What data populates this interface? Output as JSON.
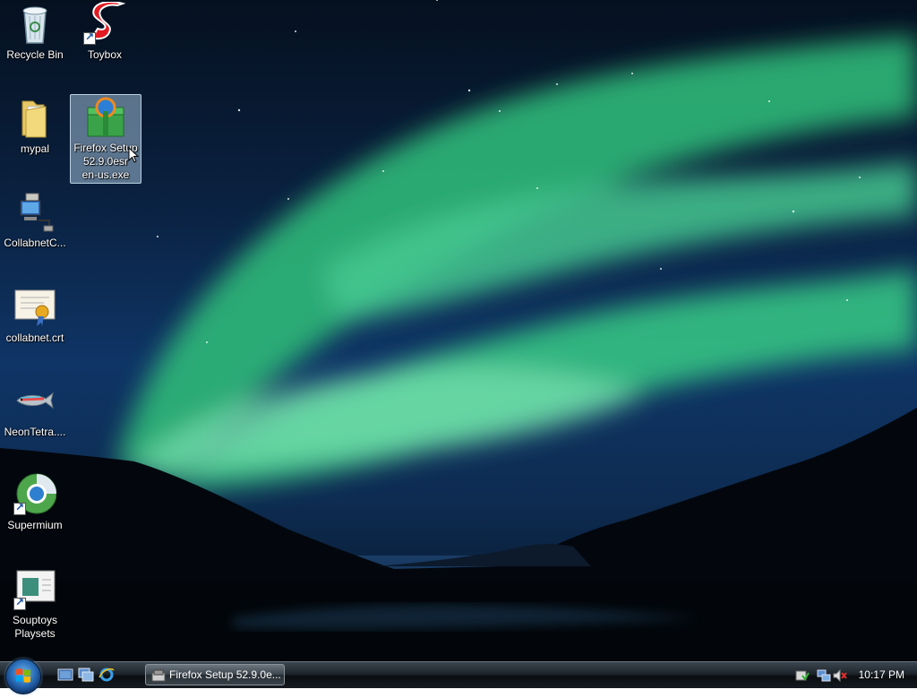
{
  "desktop": {
    "icons": [
      {
        "label": "Recycle Bin",
        "icon": "recycle-bin-icon"
      },
      {
        "label": "Toybox",
        "icon": "toybox-icon"
      },
      {
        "label": "mypal",
        "icon": "folder-icon"
      },
      {
        "label": "Firefox Setup\n52.9.0esr\nen-us.exe",
        "icon": "installer-icon",
        "selected": true
      },
      {
        "label": "CollabnetC...",
        "icon": "network-computer-icon"
      },
      {
        "label": "collabnet.crt",
        "icon": "certificate-icon"
      },
      {
        "label": "NeonTetra....",
        "icon": "fish-icon"
      },
      {
        "label": "Supermium",
        "icon": "browser-globe-icon"
      },
      {
        "label": "Souptoys\nPlaysets",
        "icon": "souptoys-icon"
      }
    ]
  },
  "taskbar": {
    "start_button": "start-orb-icon",
    "quick_launch": [
      "show-desktop-icon",
      "switch-windows-icon",
      "internet-explorer-icon"
    ],
    "task_buttons": [
      {
        "label": "Firefox Setup 52.9.0e...",
        "icon": "installer-icon"
      }
    ],
    "tray_icons": [
      "security-shield-icon",
      "network-icon",
      "volume-muted-icon"
    ],
    "clock": "10:17 PM"
  },
  "colors": {
    "aurora": "#3fd089",
    "sky": "#0f3566",
    "taskbar": "#1d242b"
  }
}
